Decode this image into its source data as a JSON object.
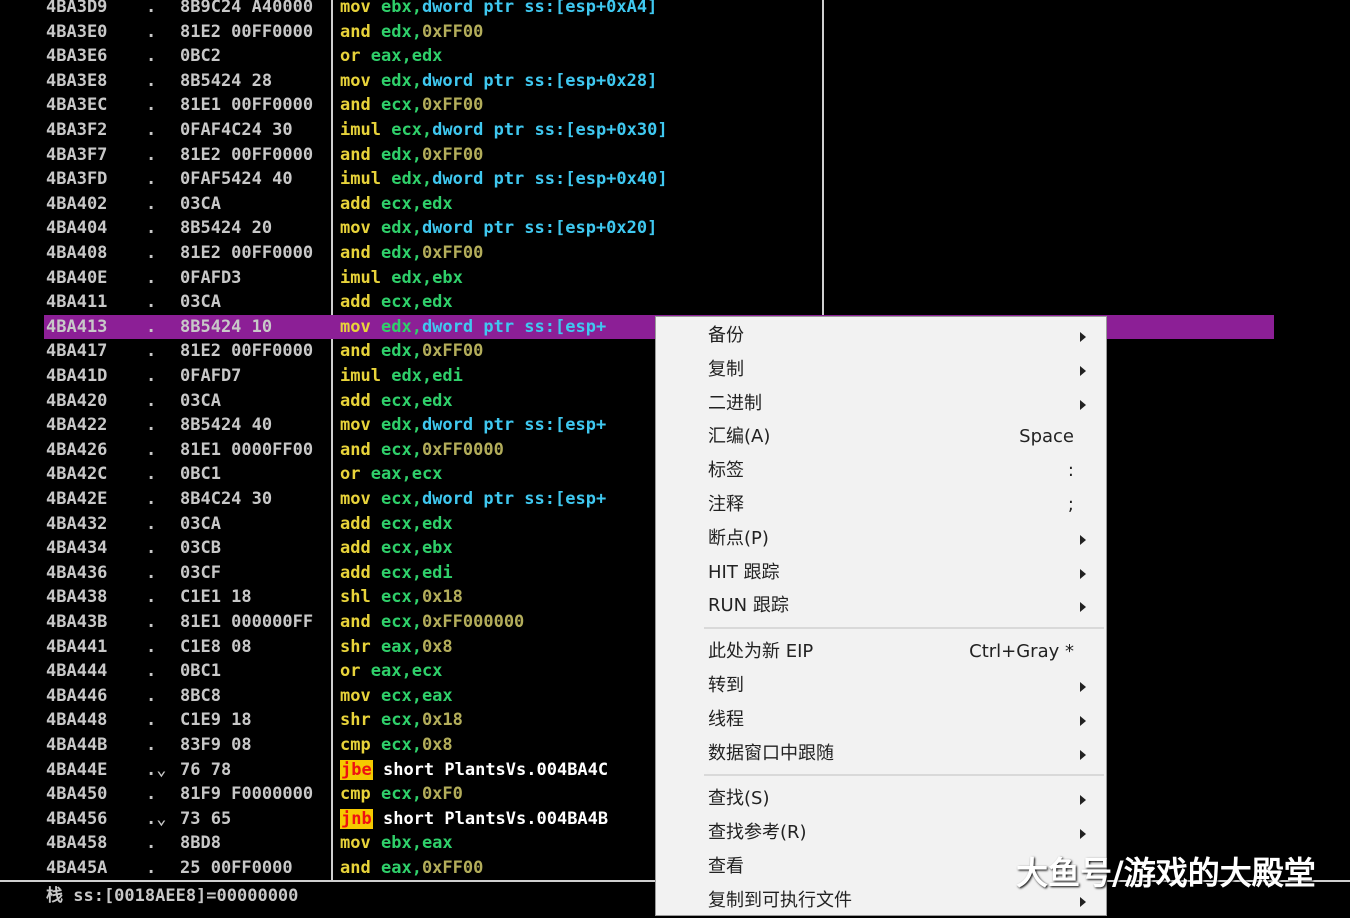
{
  "disassembly": {
    "rows": [
      {
        "address": "4BA3D9",
        "mark": ".",
        "hex": "8B9C24 A40000",
        "tokens": [
          {
            "t": "mn",
            "v": "mov"
          },
          {
            "t": "txt",
            "v": " "
          },
          {
            "t": "reg",
            "v": "ebx"
          },
          {
            "t": "txt",
            "v": ","
          },
          {
            "t": "ptr",
            "v": "dword ptr "
          },
          {
            "t": "mem",
            "v": "ss:[esp+0xA4]"
          }
        ]
      },
      {
        "address": "4BA3E0",
        "mark": ".",
        "hex": "81E2 00FF0000",
        "tokens": [
          {
            "t": "mn",
            "v": "and"
          },
          {
            "t": "txt",
            "v": " "
          },
          {
            "t": "reg",
            "v": "edx"
          },
          {
            "t": "txt",
            "v": ","
          },
          {
            "t": "num",
            "v": "0xFF00"
          }
        ]
      },
      {
        "address": "4BA3E6",
        "mark": ".",
        "hex": "0BC2",
        "tokens": [
          {
            "t": "mn",
            "v": "or"
          },
          {
            "t": "txt",
            "v": " "
          },
          {
            "t": "reg",
            "v": "eax"
          },
          {
            "t": "txt",
            "v": ","
          },
          {
            "t": "reg",
            "v": "edx"
          }
        ]
      },
      {
        "address": "4BA3E8",
        "mark": ".",
        "hex": "8B5424 28",
        "tokens": [
          {
            "t": "mn",
            "v": "mov"
          },
          {
            "t": "txt",
            "v": " "
          },
          {
            "t": "reg",
            "v": "edx"
          },
          {
            "t": "txt",
            "v": ","
          },
          {
            "t": "ptr",
            "v": "dword ptr "
          },
          {
            "t": "mem",
            "v": "ss:[esp+0x28]"
          }
        ]
      },
      {
        "address": "4BA3EC",
        "mark": ".",
        "hex": "81E1 00FF0000",
        "tokens": [
          {
            "t": "mn",
            "v": "and"
          },
          {
            "t": "txt",
            "v": " "
          },
          {
            "t": "reg",
            "v": "ecx"
          },
          {
            "t": "txt",
            "v": ","
          },
          {
            "t": "num",
            "v": "0xFF00"
          }
        ]
      },
      {
        "address": "4BA3F2",
        "mark": ".",
        "hex": "0FAF4C24 30",
        "tokens": [
          {
            "t": "mn",
            "v": "imul"
          },
          {
            "t": "txt",
            "v": " "
          },
          {
            "t": "reg",
            "v": "ecx"
          },
          {
            "t": "txt",
            "v": ","
          },
          {
            "t": "ptr",
            "v": "dword ptr "
          },
          {
            "t": "mem",
            "v": "ss:[esp+0x30]"
          }
        ]
      },
      {
        "address": "4BA3F7",
        "mark": ".",
        "hex": "81E2 00FF0000",
        "tokens": [
          {
            "t": "mn",
            "v": "and"
          },
          {
            "t": "txt",
            "v": " "
          },
          {
            "t": "reg",
            "v": "edx"
          },
          {
            "t": "txt",
            "v": ","
          },
          {
            "t": "num",
            "v": "0xFF00"
          }
        ]
      },
      {
        "address": "4BA3FD",
        "mark": ".",
        "hex": "0FAF5424 40",
        "tokens": [
          {
            "t": "mn",
            "v": "imul"
          },
          {
            "t": "txt",
            "v": " "
          },
          {
            "t": "reg",
            "v": "edx"
          },
          {
            "t": "txt",
            "v": ","
          },
          {
            "t": "ptr",
            "v": "dword ptr "
          },
          {
            "t": "mem",
            "v": "ss:[esp+0x40]"
          }
        ]
      },
      {
        "address": "4BA402",
        "mark": ".",
        "hex": "03CA",
        "tokens": [
          {
            "t": "mn",
            "v": "add"
          },
          {
            "t": "txt",
            "v": " "
          },
          {
            "t": "reg",
            "v": "ecx"
          },
          {
            "t": "txt",
            "v": ","
          },
          {
            "t": "reg",
            "v": "edx"
          }
        ]
      },
      {
        "address": "4BA404",
        "mark": ".",
        "hex": "8B5424 20",
        "tokens": [
          {
            "t": "mn",
            "v": "mov"
          },
          {
            "t": "txt",
            "v": " "
          },
          {
            "t": "reg",
            "v": "edx"
          },
          {
            "t": "txt",
            "v": ","
          },
          {
            "t": "ptr",
            "v": "dword ptr "
          },
          {
            "t": "mem",
            "v": "ss:[esp+0x20]"
          }
        ]
      },
      {
        "address": "4BA408",
        "mark": ".",
        "hex": "81E2 00FF0000",
        "tokens": [
          {
            "t": "mn",
            "v": "and"
          },
          {
            "t": "txt",
            "v": " "
          },
          {
            "t": "reg",
            "v": "edx"
          },
          {
            "t": "txt",
            "v": ","
          },
          {
            "t": "num",
            "v": "0xFF00"
          }
        ]
      },
      {
        "address": "4BA40E",
        "mark": ".",
        "hex": "0FAFD3",
        "tokens": [
          {
            "t": "mn",
            "v": "imul"
          },
          {
            "t": "txt",
            "v": " "
          },
          {
            "t": "reg",
            "v": "edx"
          },
          {
            "t": "txt",
            "v": ","
          },
          {
            "t": "reg",
            "v": "ebx"
          }
        ]
      },
      {
        "address": "4BA411",
        "mark": ".",
        "hex": "03CA",
        "tokens": [
          {
            "t": "mn",
            "v": "add"
          },
          {
            "t": "txt",
            "v": " "
          },
          {
            "t": "reg",
            "v": "ecx"
          },
          {
            "t": "txt",
            "v": ","
          },
          {
            "t": "reg",
            "v": "edx"
          }
        ]
      },
      {
        "address": "4BA413",
        "mark": ".",
        "hex": "8B5424 10",
        "selected": true,
        "tokens": [
          {
            "t": "mn",
            "v": "mov"
          },
          {
            "t": "txt",
            "v": " "
          },
          {
            "t": "reg",
            "v": "edx"
          },
          {
            "t": "txt",
            "v": ","
          },
          {
            "t": "ptr",
            "v": "dword ptr "
          },
          {
            "t": "mem",
            "v": "ss:[esp+"
          }
        ]
      },
      {
        "address": "4BA417",
        "mark": ".",
        "hex": "81E2 00FF0000",
        "tokens": [
          {
            "t": "mn",
            "v": "and"
          },
          {
            "t": "txt",
            "v": " "
          },
          {
            "t": "reg",
            "v": "edx"
          },
          {
            "t": "txt",
            "v": ","
          },
          {
            "t": "num",
            "v": "0xFF00"
          }
        ]
      },
      {
        "address": "4BA41D",
        "mark": ".",
        "hex": "0FAFD7",
        "tokens": [
          {
            "t": "mn",
            "v": "imul"
          },
          {
            "t": "txt",
            "v": " "
          },
          {
            "t": "reg",
            "v": "edx"
          },
          {
            "t": "txt",
            "v": ","
          },
          {
            "t": "reg",
            "v": "edi"
          }
        ]
      },
      {
        "address": "4BA420",
        "mark": ".",
        "hex": "03CA",
        "tokens": [
          {
            "t": "mn",
            "v": "add"
          },
          {
            "t": "txt",
            "v": " "
          },
          {
            "t": "reg",
            "v": "ecx"
          },
          {
            "t": "txt",
            "v": ","
          },
          {
            "t": "reg",
            "v": "edx"
          }
        ]
      },
      {
        "address": "4BA422",
        "mark": ".",
        "hex": "8B5424 40",
        "tokens": [
          {
            "t": "mn",
            "v": "mov"
          },
          {
            "t": "txt",
            "v": " "
          },
          {
            "t": "reg",
            "v": "edx"
          },
          {
            "t": "txt",
            "v": ","
          },
          {
            "t": "ptr",
            "v": "dword ptr "
          },
          {
            "t": "mem",
            "v": "ss:[esp+"
          }
        ]
      },
      {
        "address": "4BA426",
        "mark": ".",
        "hex": "81E1 0000FF00",
        "tokens": [
          {
            "t": "mn",
            "v": "and"
          },
          {
            "t": "txt",
            "v": " "
          },
          {
            "t": "reg",
            "v": "ecx"
          },
          {
            "t": "txt",
            "v": ","
          },
          {
            "t": "num",
            "v": "0xFF0000"
          }
        ]
      },
      {
        "address": "4BA42C",
        "mark": ".",
        "hex": "0BC1",
        "tokens": [
          {
            "t": "mn",
            "v": "or"
          },
          {
            "t": "txt",
            "v": " "
          },
          {
            "t": "reg",
            "v": "eax"
          },
          {
            "t": "txt",
            "v": ","
          },
          {
            "t": "reg",
            "v": "ecx"
          }
        ]
      },
      {
        "address": "4BA42E",
        "mark": ".",
        "hex": "8B4C24 30",
        "tokens": [
          {
            "t": "mn",
            "v": "mov"
          },
          {
            "t": "txt",
            "v": " "
          },
          {
            "t": "reg",
            "v": "ecx"
          },
          {
            "t": "txt",
            "v": ","
          },
          {
            "t": "ptr",
            "v": "dword ptr "
          },
          {
            "t": "mem",
            "v": "ss:[esp+"
          }
        ]
      },
      {
        "address": "4BA432",
        "mark": ".",
        "hex": "03CA",
        "tokens": [
          {
            "t": "mn",
            "v": "add"
          },
          {
            "t": "txt",
            "v": " "
          },
          {
            "t": "reg",
            "v": "ecx"
          },
          {
            "t": "txt",
            "v": ","
          },
          {
            "t": "reg",
            "v": "edx"
          }
        ]
      },
      {
        "address": "4BA434",
        "mark": ".",
        "hex": "03CB",
        "tokens": [
          {
            "t": "mn",
            "v": "add"
          },
          {
            "t": "txt",
            "v": " "
          },
          {
            "t": "reg",
            "v": "ecx"
          },
          {
            "t": "txt",
            "v": ","
          },
          {
            "t": "reg",
            "v": "ebx"
          }
        ]
      },
      {
        "address": "4BA436",
        "mark": ".",
        "hex": "03CF",
        "tokens": [
          {
            "t": "mn",
            "v": "add"
          },
          {
            "t": "txt",
            "v": " "
          },
          {
            "t": "reg",
            "v": "ecx"
          },
          {
            "t": "txt",
            "v": ","
          },
          {
            "t": "reg",
            "v": "edi"
          }
        ]
      },
      {
        "address": "4BA438",
        "mark": ".",
        "hex": "C1E1 18",
        "tokens": [
          {
            "t": "mn",
            "v": "shl"
          },
          {
            "t": "txt",
            "v": " "
          },
          {
            "t": "reg",
            "v": "ecx"
          },
          {
            "t": "txt",
            "v": ","
          },
          {
            "t": "num",
            "v": "0x18"
          }
        ]
      },
      {
        "address": "4BA43B",
        "mark": ".",
        "hex": "81E1 000000FF",
        "tokens": [
          {
            "t": "mn",
            "v": "and"
          },
          {
            "t": "txt",
            "v": " "
          },
          {
            "t": "reg",
            "v": "ecx"
          },
          {
            "t": "txt",
            "v": ","
          },
          {
            "t": "num",
            "v": "0xFF000000"
          }
        ]
      },
      {
        "address": "4BA441",
        "mark": ".",
        "hex": "C1E8 08",
        "tokens": [
          {
            "t": "mn",
            "v": "shr"
          },
          {
            "t": "txt",
            "v": " "
          },
          {
            "t": "reg",
            "v": "eax"
          },
          {
            "t": "txt",
            "v": ","
          },
          {
            "t": "num",
            "v": "0x8"
          }
        ]
      },
      {
        "address": "4BA444",
        "mark": ".",
        "hex": "0BC1",
        "tokens": [
          {
            "t": "mn",
            "v": "or"
          },
          {
            "t": "txt",
            "v": " "
          },
          {
            "t": "reg",
            "v": "eax"
          },
          {
            "t": "txt",
            "v": ","
          },
          {
            "t": "reg",
            "v": "ecx"
          }
        ]
      },
      {
        "address": "4BA446",
        "mark": ".",
        "hex": "8BC8",
        "tokens": [
          {
            "t": "mn",
            "v": "mov"
          },
          {
            "t": "txt",
            "v": " "
          },
          {
            "t": "reg",
            "v": "ecx"
          },
          {
            "t": "txt",
            "v": ","
          },
          {
            "t": "reg",
            "v": "eax"
          }
        ]
      },
      {
        "address": "4BA448",
        "mark": ".",
        "hex": "C1E9 18",
        "tokens": [
          {
            "t": "mn",
            "v": "shr"
          },
          {
            "t": "txt",
            "v": " "
          },
          {
            "t": "reg",
            "v": "ecx"
          },
          {
            "t": "txt",
            "v": ","
          },
          {
            "t": "num",
            "v": "0x18"
          }
        ]
      },
      {
        "address": "4BA44B",
        "mark": ".",
        "hex": "83F9 08",
        "tokens": [
          {
            "t": "mn",
            "v": "cmp"
          },
          {
            "t": "txt",
            "v": " "
          },
          {
            "t": "reg",
            "v": "ecx"
          },
          {
            "t": "txt",
            "v": ","
          },
          {
            "t": "num",
            "v": "0x8"
          }
        ]
      },
      {
        "address": "4BA44E",
        "mark": ".⌄",
        "hex": "76 78",
        "tokens": [
          {
            "t": "jmp",
            "v": "jbe"
          },
          {
            "t": "txt",
            "v": " "
          },
          {
            "t": "lbl",
            "v": "short PlantsVs.004BA4C"
          }
        ]
      },
      {
        "address": "4BA450",
        "mark": ".",
        "hex": "81F9 F0000000",
        "tokens": [
          {
            "t": "mn",
            "v": "cmp"
          },
          {
            "t": "txt",
            "v": " "
          },
          {
            "t": "reg",
            "v": "ecx"
          },
          {
            "t": "txt",
            "v": ","
          },
          {
            "t": "num",
            "v": "0xF0"
          }
        ]
      },
      {
        "address": "4BA456",
        "mark": ".⌄",
        "hex": "73 65",
        "tokens": [
          {
            "t": "jmp",
            "v": "jnb"
          },
          {
            "t": "txt",
            "v": " "
          },
          {
            "t": "lbl",
            "v": "short PlantsVs.004BA4B"
          }
        ]
      },
      {
        "address": "4BA458",
        "mark": ".",
        "hex": "8BD8",
        "tokens": [
          {
            "t": "mn",
            "v": "mov"
          },
          {
            "t": "txt",
            "v": " "
          },
          {
            "t": "reg",
            "v": "ebx"
          },
          {
            "t": "txt",
            "v": ","
          },
          {
            "t": "reg",
            "v": "eax"
          }
        ]
      },
      {
        "address": "4BA45A",
        "mark": ".",
        "hex": "25 00FF0000",
        "tokens": [
          {
            "t": "mn",
            "v": "and"
          },
          {
            "t": "txt",
            "v": " "
          },
          {
            "t": "reg",
            "v": "eax"
          },
          {
            "t": "txt",
            "v": ","
          },
          {
            "t": "num",
            "v": "0xFF00"
          }
        ]
      }
    ]
  },
  "status": {
    "text": "栈 ss:[0018AEE8]=00000000"
  },
  "context_menu": {
    "items": [
      {
        "label": "备份",
        "shortcut": "",
        "submenu": true
      },
      {
        "label": "复制",
        "shortcut": "",
        "submenu": true
      },
      {
        "label": "二进制",
        "shortcut": "",
        "submenu": true
      },
      {
        "label": "汇编(A)",
        "shortcut": "Space",
        "submenu": false
      },
      {
        "label": "标签",
        "shortcut": ":",
        "submenu": false
      },
      {
        "label": "注释",
        "shortcut": ";",
        "submenu": false
      },
      {
        "label": "断点(P)",
        "shortcut": "",
        "submenu": true
      },
      {
        "label": "HIT 跟踪",
        "shortcut": "",
        "submenu": true
      },
      {
        "label": "RUN 跟踪",
        "shortcut": "",
        "submenu": true
      },
      {
        "separator": true
      },
      {
        "label": "此处为新 EIP",
        "shortcut": "Ctrl+Gray *",
        "submenu": false
      },
      {
        "label": "转到",
        "shortcut": "",
        "submenu": true
      },
      {
        "label": "线程",
        "shortcut": "",
        "submenu": true
      },
      {
        "label": "数据窗口中跟随",
        "shortcut": "",
        "submenu": true
      },
      {
        "separator": true
      },
      {
        "label": "查找(S)",
        "shortcut": "",
        "submenu": true
      },
      {
        "label": "查找参考(R)",
        "shortcut": "",
        "submenu": true
      },
      {
        "label": "查看",
        "shortcut": "",
        "submenu": false
      },
      {
        "label": "复制到可执行文件",
        "shortcut": "",
        "submenu": true
      }
    ]
  },
  "watermark": "大鱼号/游戏的大殿堂",
  "colors": {
    "selection": "#8c1f96",
    "mnemonic": "#e8d33a",
    "register": "#2fd06a",
    "memory": "#3fc8f0",
    "jump_bg": "#f5c900",
    "jump_fg": "#ee1111"
  }
}
